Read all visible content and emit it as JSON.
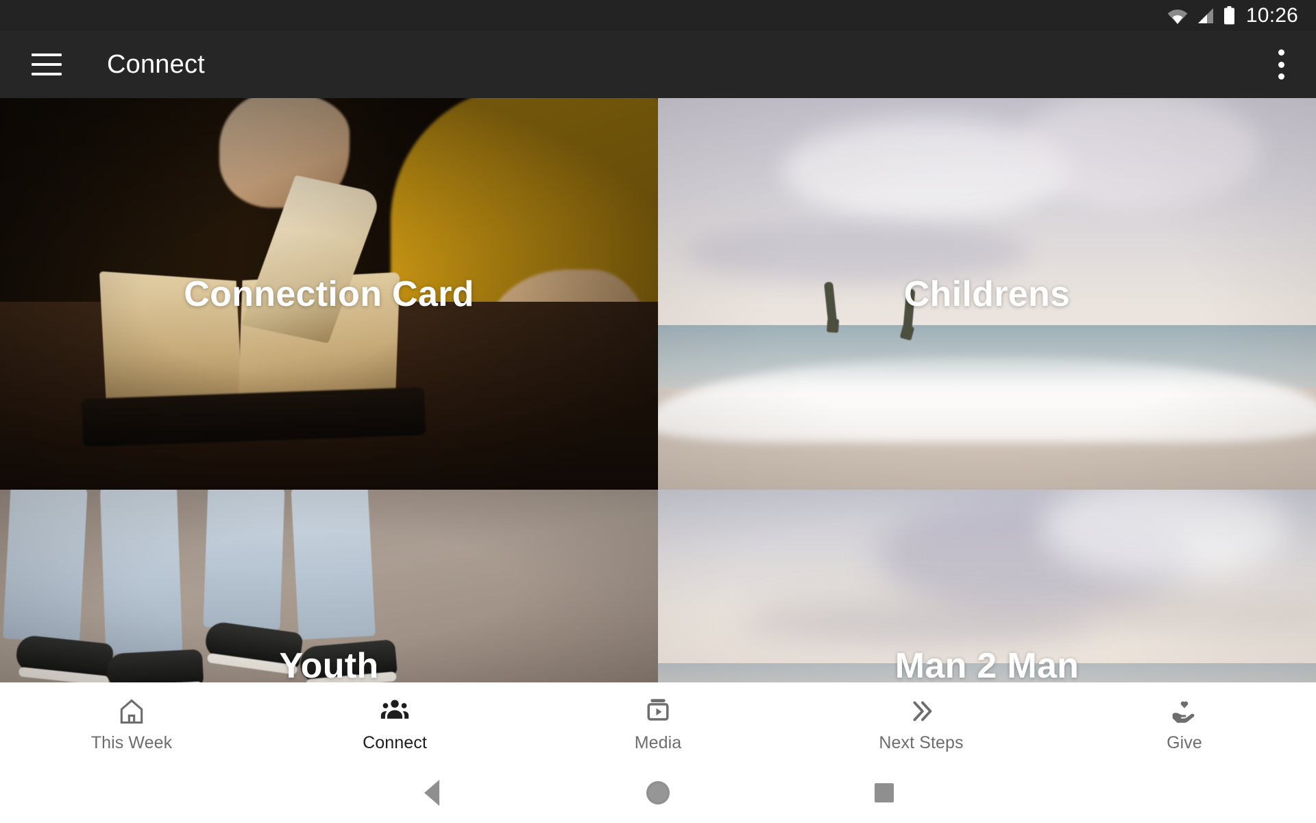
{
  "status_bar": {
    "time": "10:26",
    "icons": [
      "wifi-icon",
      "cell-signal-icon",
      "battery-icon"
    ]
  },
  "app_bar": {
    "menu_icon": "hamburger-menu-icon",
    "title": "Connect",
    "overflow_icon": "more-vertical-icon"
  },
  "tiles": [
    {
      "label": "Connection Card",
      "art": "open-bible-on-wooden-table"
    },
    {
      "label": "Childrens",
      "art": "children-running-on-beach"
    },
    {
      "label": "Youth",
      "art": "teen-sneakers-on-pavement"
    },
    {
      "label": "Man 2 Man",
      "art": "cloudy-sky-over-ocean"
    }
  ],
  "tab_bar": {
    "active_index": 1,
    "tabs": [
      {
        "label": "This Week",
        "icon": "home-icon"
      },
      {
        "label": "Connect",
        "icon": "people-group-icon"
      },
      {
        "label": "Media",
        "icon": "video-player-icon"
      },
      {
        "label": "Next Steps",
        "icon": "double-chevron-right-icon"
      },
      {
        "label": "Give",
        "icon": "hand-holding-heart-icon"
      }
    ]
  },
  "system_nav": {
    "back": "back-triangle-icon",
    "home": "home-circle-icon",
    "recents": "recents-square-icon"
  },
  "colors": {
    "status_bar_bg": "#232323",
    "app_bar_bg": "#262626",
    "tab_bar_bg": "#ffffff",
    "tab_active": "#1d1d1d",
    "tab_inactive": "#6d6d6d",
    "tile_label": "#ffffff"
  }
}
